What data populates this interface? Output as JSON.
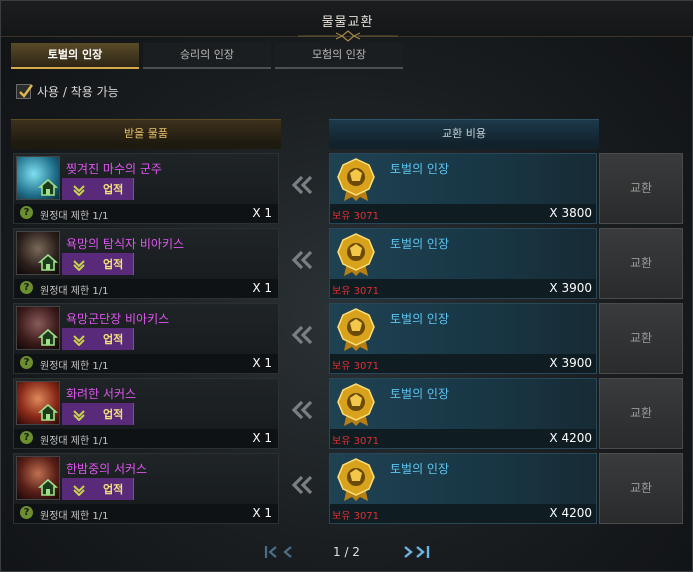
{
  "window": {
    "title": "물물교환"
  },
  "tabs": [
    {
      "label": "토벌의 인장",
      "active": true
    },
    {
      "label": "승리의 인장",
      "active": false
    },
    {
      "label": "모험의 인장",
      "active": false
    }
  ],
  "filter": {
    "label": "사용 / 착용 가능",
    "checked": true
  },
  "columns": {
    "receive": "받을 물품",
    "cost": "교환 비용"
  },
  "rows": [
    {
      "item_name": "찢겨진 마수의 군주",
      "badge": "업적",
      "limit": "원정대 제한 1/1",
      "qty": "X 1",
      "cost_name": "토벌의 인장",
      "owned": "보유 3071",
      "cost_qty": "X 3800",
      "button": "교환",
      "thumb_color": "#2a9ab0"
    },
    {
      "item_name": "욕망의 탐식자 비아키스",
      "badge": "업적",
      "limit": "원정대 제한 1/1",
      "qty": "X 1",
      "cost_name": "토벌의 인장",
      "owned": "보유 3071",
      "cost_qty": "X 3900",
      "button": "교환",
      "thumb_color": "#3a2a2a"
    },
    {
      "item_name": "욕망군단장 비아키스",
      "badge": "업적",
      "limit": "원정대 제한 1/1",
      "qty": "X 1",
      "cost_name": "토벌의 인장",
      "owned": "보유 3071",
      "cost_qty": "X 3900",
      "button": "교환",
      "thumb_color": "#3a2222"
    },
    {
      "item_name": "화려한 서커스",
      "badge": "업적",
      "limit": "원정대 제한 1/1",
      "qty": "X 1",
      "cost_name": "토벌의 인장",
      "owned": "보유 3071",
      "cost_qty": "X 4200",
      "button": "교환",
      "thumb_color": "#8a3020"
    },
    {
      "item_name": "한밤중의 서커스",
      "badge": "업적",
      "limit": "원정대 제한 1/1",
      "qty": "X 1",
      "cost_name": "토벌의 인장",
      "owned": "보유 3071",
      "cost_qty": "X 4200",
      "button": "교환",
      "thumb_color": "#5a2a20"
    }
  ],
  "pager": {
    "text": "1 / 2"
  },
  "colors": {
    "accent_gold": "#d6a84a",
    "item_purple": "#e256f2",
    "cost_blue": "#5fc6f2",
    "owned_red": "#e03030"
  },
  "icons": [
    "check-icon",
    "home-icon",
    "chevron-up-icon",
    "question-icon",
    "double-left-arrow-icon",
    "medal-icon",
    "first-page-icon",
    "prev-page-icon",
    "next-page-icon",
    "last-page-icon"
  ]
}
